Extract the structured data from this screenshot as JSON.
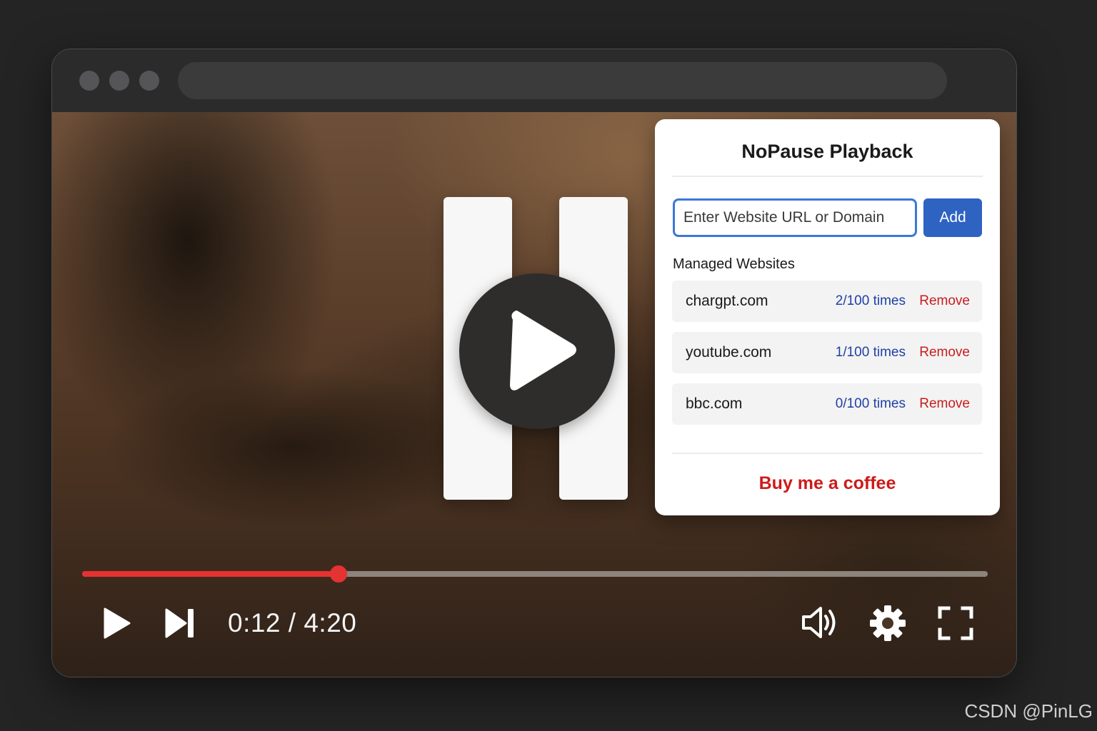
{
  "popup": {
    "title": "NoPause Playback",
    "input_placeholder": "Enter Website URL or Domain",
    "add_label": "Add",
    "managed_label": "Managed Websites",
    "sites": [
      {
        "domain": "chargpt.com",
        "count": "2/100 times",
        "remove": "Remove"
      },
      {
        "domain": "youtube.com",
        "count": "1/100 times",
        "remove": "Remove"
      },
      {
        "domain": "bbc.com",
        "count": "0/100 times",
        "remove": "Remove"
      }
    ],
    "coffee_label": "Buy me a coffee"
  },
  "player": {
    "time": "0:12 / 4:20",
    "progress_fraction": 0.283,
    "icons": [
      "play-icon",
      "next-icon",
      "volume-icon",
      "gear-icon",
      "fullscreen-icon"
    ]
  },
  "colors": {
    "accent_blue": "#2e63c2",
    "remove_red": "#c81d1d",
    "progress_red": "#e53232"
  },
  "watermark": "CSDN @PinLG"
}
